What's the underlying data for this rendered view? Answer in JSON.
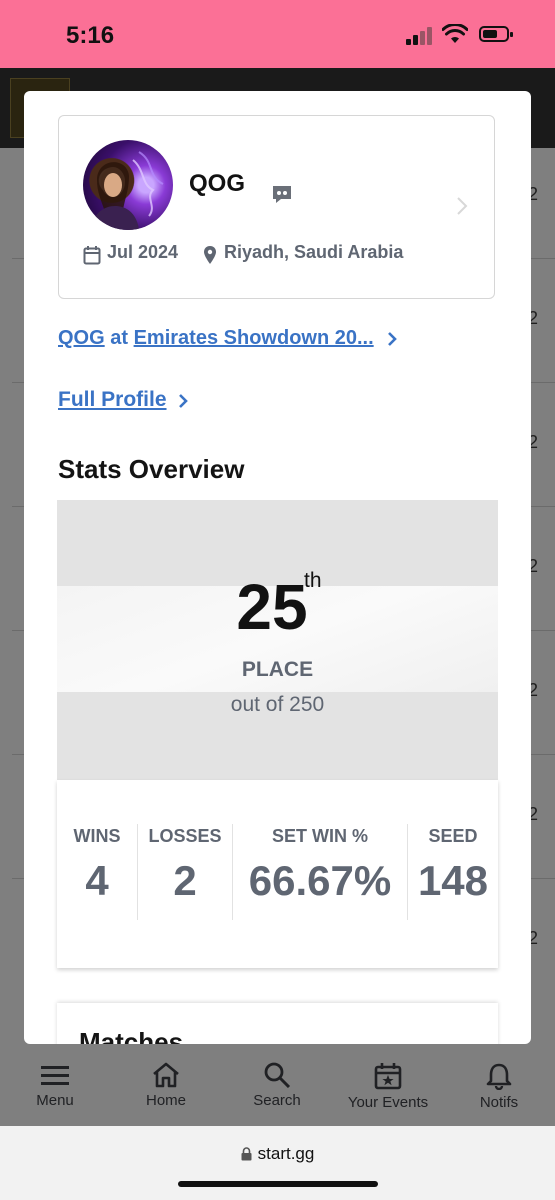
{
  "status_bar": {
    "time": "5:16"
  },
  "background_page": {
    "row_suffix": "2"
  },
  "profile_card": {
    "player_tag": "QOG",
    "date": "Jul 2024",
    "location": "Riyadh, Saudi Arabia"
  },
  "links": {
    "player": "QOG",
    "at": "at",
    "event": "Emirates Showdown 20...",
    "full_profile": "Full Profile"
  },
  "stats_overview": {
    "heading": "Stats Overview",
    "placement": {
      "value": "25",
      "suffix": "th",
      "label": "PLACE",
      "out_of": "out of 250"
    },
    "stats": [
      {
        "label": "WINS",
        "value": "4"
      },
      {
        "label": "LOSSES",
        "value": "2"
      },
      {
        "label": "SET WIN %",
        "value": "66.67%"
      },
      {
        "label": "SEED",
        "value": "148"
      }
    ]
  },
  "matches": {
    "heading": "Matches"
  },
  "bottom_nav": [
    {
      "label": "Menu",
      "icon": "menu-icon"
    },
    {
      "label": "Home",
      "icon": "home-icon"
    },
    {
      "label": "Search",
      "icon": "search-icon"
    },
    {
      "label": "Your Events",
      "icon": "calendar-star-icon"
    },
    {
      "label": "Notifs",
      "icon": "bell-icon"
    }
  ],
  "browser": {
    "url": "start.gg"
  },
  "colors": {
    "status_bar": "#fb7096",
    "link": "#3a73c5",
    "muted_text": "#5f6672"
  }
}
